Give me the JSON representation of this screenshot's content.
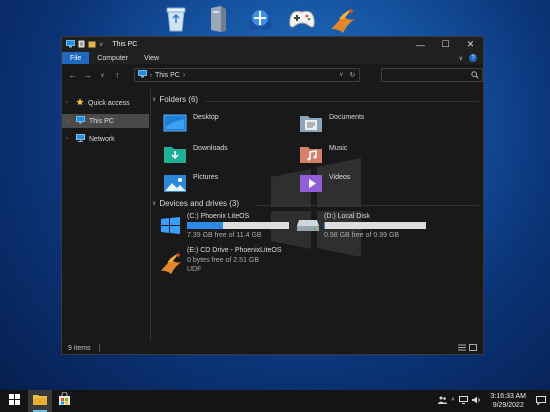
{
  "desktop": {
    "icons": [
      "recycle-bin-icon",
      "files-icon",
      "network-icon",
      "gamepad-icon",
      "phoenix-icon"
    ]
  },
  "window": {
    "title": "This PC",
    "qa_dropdown": "∨",
    "controls": {
      "minimize": "—",
      "maximize": "☐",
      "close": "✕"
    },
    "ribbon": {
      "tabs": [
        "File",
        "Computer",
        "View"
      ],
      "active": "File",
      "collapse": "∨",
      "help": "?"
    },
    "nav": {
      "back": "←",
      "forward": "→",
      "recent": "∨",
      "up": "↑",
      "address": {
        "location": "This PC",
        "sep1": "›",
        "sep2": "›",
        "dropdown": "∨",
        "refresh": "↻"
      },
      "search_placeholder": ""
    },
    "sidebar": {
      "items": [
        {
          "label": "Quick access",
          "icon": "star-icon"
        },
        {
          "label": "This PC",
          "icon": "monitor-icon",
          "selected": true
        },
        {
          "label": "Network",
          "icon": "network-icon"
        }
      ]
    },
    "folders": {
      "heading": "Folders (6)",
      "items": [
        {
          "label": "Desktop"
        },
        {
          "label": "Documents"
        },
        {
          "label": "Downloads"
        },
        {
          "label": "Music"
        },
        {
          "label": "Pictures"
        },
        {
          "label": "Videos"
        }
      ]
    },
    "devices": {
      "heading": "Devices and drives (3)",
      "drives": [
        {
          "name": "(C:) Phoenix LiteOS",
          "free_text": "7.39 GB free of 11.4 GB",
          "used_fraction": 0.35
        },
        {
          "name": "(D:) Local Disk",
          "free_text": "0.98 GB free of 0.99 GB",
          "used_fraction": 0.01
        },
        {
          "name": "(E:) CD Drive - PhoenixLiteOS",
          "free_text": "0 bytes free of 2.51 GB",
          "fs": "UDF"
        }
      ]
    },
    "status": {
      "count": "9 items"
    }
  },
  "taskbar": {
    "clock_time": "3:16:33 AM",
    "clock_date": "9/29/2022",
    "accent": "#76b9ed"
  },
  "colors": {
    "accent": "#1f67c0",
    "drive_fill": "#2f8ae6"
  }
}
